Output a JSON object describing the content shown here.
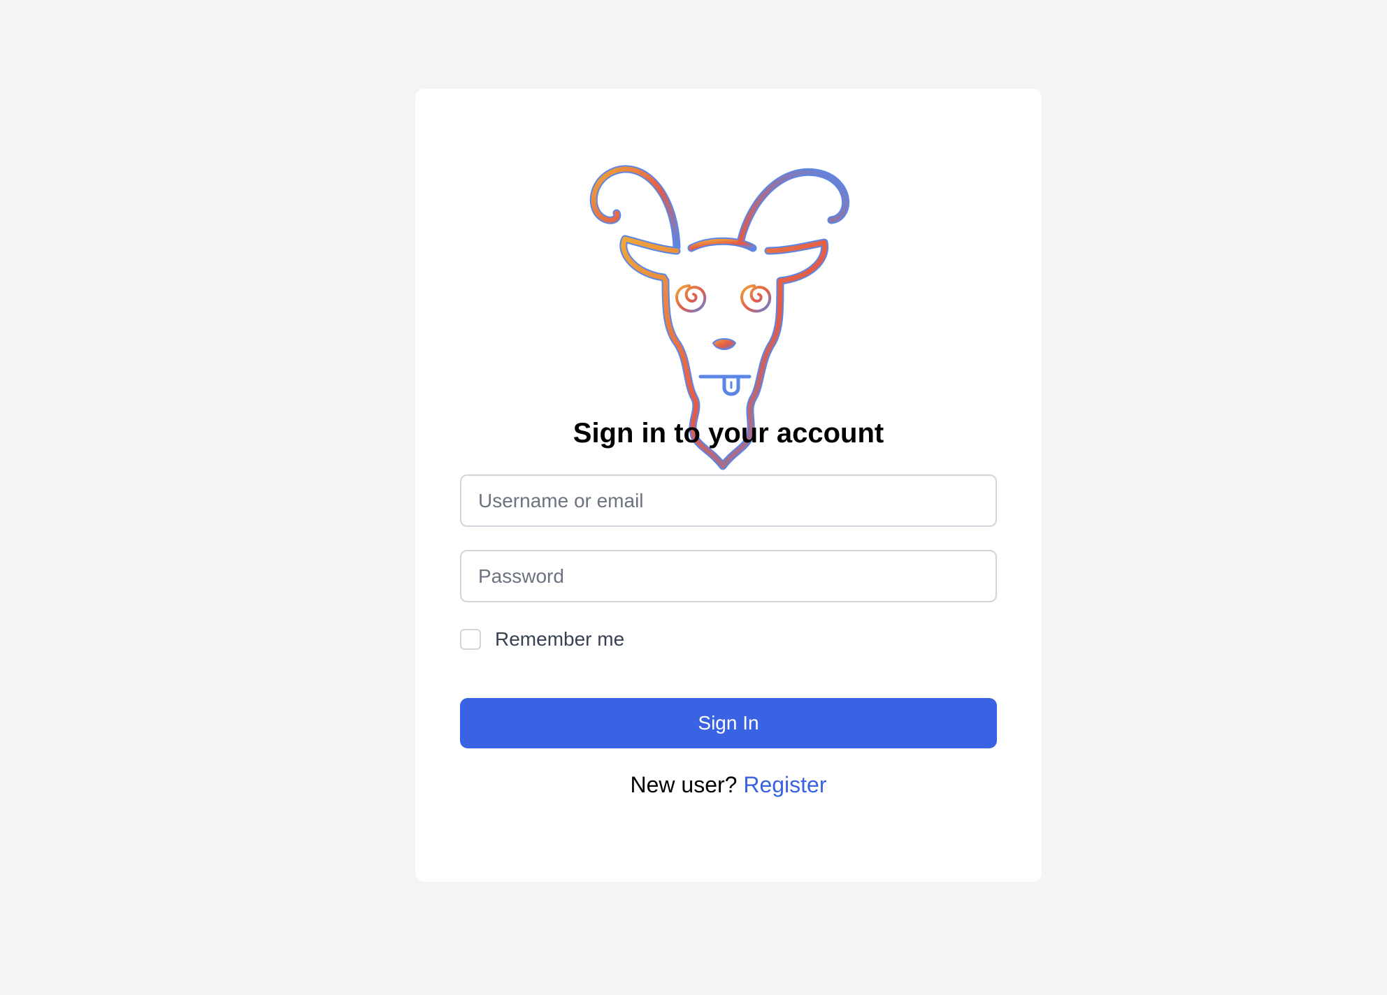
{
  "brand": {
    "logo_icon": "goat-logo-icon",
    "gradient_colors": [
      "#f0a63a",
      "#e25b4a",
      "#5b86e5"
    ]
  },
  "form": {
    "title": "Sign in to your account",
    "username_placeholder": "Username or email",
    "password_placeholder": "Password",
    "remember_label": "Remember me",
    "submit_label": "Sign In"
  },
  "footer": {
    "prompt": "New user?",
    "register_label": "Register"
  },
  "colors": {
    "background": "#f3f4f6",
    "primary": "#3a63e4",
    "link": "#3a63e4"
  }
}
